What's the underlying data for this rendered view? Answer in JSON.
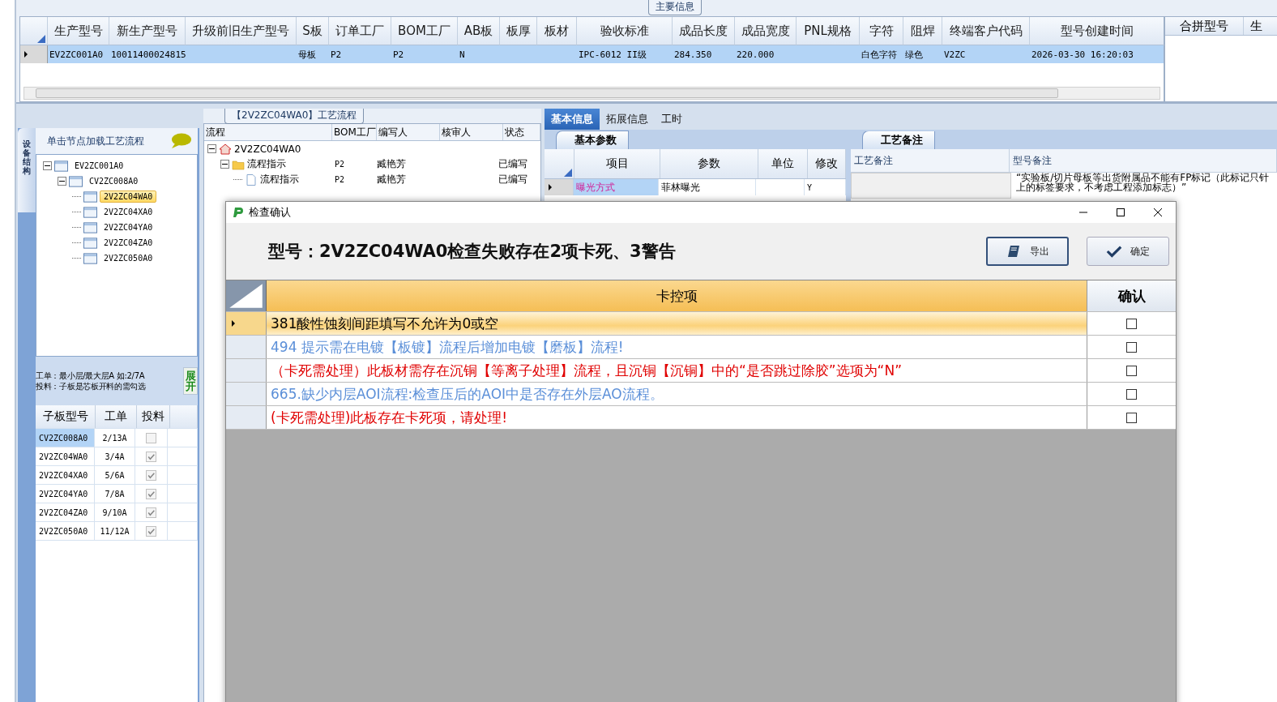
{
  "main_info": {
    "title": "主要信息",
    "columns": [
      "生产型号",
      "新生产型号",
      "升级前旧生产型号",
      "S板",
      "订单工厂",
      "BOM工厂",
      "AB板",
      "板厚",
      "板材",
      "验收标准",
      "成品长度",
      "成品宽度",
      "PNL规格",
      "字符",
      "阻焊",
      "终端客户代码",
      "型号创建时间"
    ],
    "rows": [
      {
        "selected": true,
        "cells": [
          "EV2ZC001A0",
          "10011400024815",
          "",
          "母板",
          "P2",
          "P2",
          "N",
          "",
          "",
          "IPC-6012 II级",
          "284.350",
          "220.000",
          "",
          "白色字符",
          "绿色",
          "V2ZC",
          "2026-03-30 16:20:03"
        ]
      }
    ]
  },
  "merge_table": {
    "columns": [
      "合拼型号",
      "生"
    ]
  },
  "left_panel": {
    "side_tab": "设备结构",
    "hint": "单击节点加载工艺流程",
    "tree": [
      {
        "label": "EV2ZC001A0",
        "expanded": true,
        "selected": false,
        "children": [
          {
            "label": "CV2ZC008A0",
            "expanded": true,
            "selected": false,
            "children": [
              {
                "label": "2V2ZC04WA0",
                "selected": true
              },
              {
                "label": "2V2ZC04XA0",
                "selected": false
              },
              {
                "label": "2V2ZC04YA0",
                "selected": false
              },
              {
                "label": "2V2ZC04ZA0",
                "selected": false
              },
              {
                "label": "2V2ZC050A0",
                "selected": false
              }
            ]
          }
        ]
      }
    ],
    "notes": [
      "工单：最小层/最大层A 如:2/7A",
      "投料：子板是芯板开料的需勾选"
    ],
    "expand_button": "展开",
    "sub_table": {
      "columns": [
        "子板型号",
        "工单",
        "投料"
      ],
      "rows": [
        {
          "model": "CV2ZC008A0",
          "order": "2/13A",
          "checked": false,
          "selected": true
        },
        {
          "model": "2V2ZC04WA0",
          "order": "3/4A",
          "checked": true,
          "selected": false
        },
        {
          "model": "2V2ZC04XA0",
          "order": "5/6A",
          "checked": true,
          "selected": false
        },
        {
          "model": "2V2ZC04YA0",
          "order": "7/8A",
          "checked": true,
          "selected": false
        },
        {
          "model": "2V2ZC04ZA0",
          "order": "9/10A",
          "checked": true,
          "selected": false
        },
        {
          "model": "2V2ZC050A0",
          "order": "11/12A",
          "checked": true,
          "selected": false
        }
      ]
    }
  },
  "flow_panel": {
    "title": "【2V2ZC04WA0】工艺流程",
    "columns": [
      "流程",
      "BOM工厂",
      "编写人",
      "核审人",
      "状态"
    ],
    "tree": [
      {
        "label": "2V2ZC04WA0",
        "kind": "home",
        "children": [
          {
            "label": "流程指示",
            "kind": "folder",
            "bom": "P2",
            "author": "臧艳芳",
            "status": "已编写",
            "children": [
              {
                "label": "流程指示",
                "kind": "file",
                "bom": "P2",
                "author": "臧艳芳",
                "status": "已编写"
              }
            ]
          }
        ]
      }
    ]
  },
  "info_tabs": [
    {
      "label": "基本信息",
      "selected": true
    },
    {
      "label": "拓展信息",
      "selected": false
    },
    {
      "label": "工时",
      "selected": false
    }
  ],
  "basic_params": {
    "tab": "基本参数",
    "columns": [
      "项目",
      "参数",
      "单位",
      "修改"
    ],
    "rows": [
      {
        "item": "曝光方式",
        "param": "菲林曝光",
        "modified": "Y"
      }
    ]
  },
  "process_notes": {
    "tab": "工艺备注",
    "columns": [
      "工艺备注",
      "型号备注"
    ],
    "model_note": [
      "“实验板/切片母板等出货附属品不能有FP标记（此标记只针",
      "上的标签要求，不考虑工程添加标志）”"
    ]
  },
  "dialog": {
    "title": "检查确认",
    "heading": "型号：2V2ZC04WA0检查失败存在2项卡死、3警告",
    "buttons": [
      {
        "label": "导出",
        "kind": "export"
      },
      {
        "label": "确定",
        "kind": "ok"
      }
    ],
    "columns": [
      "卡控项",
      "确认"
    ],
    "rows": [
      {
        "text": "381酸性蚀刻间距填写不允许为0或空",
        "color": "#000000",
        "selected": true,
        "checked": false
      },
      {
        "text": "494 提示需在电镀【板镀】流程后增加电镀【磨板】流程!",
        "color": "#5b8fd8",
        "selected": false,
        "checked": false
      },
      {
        "text": "（卡死需处理）此板材需存在沉铜【等离子处理】流程，且沉铜【沉铜】中的“是否跳过除胶”选项为“N”",
        "color": "#e00000",
        "selected": false,
        "checked": false
      },
      {
        "text": "665.缺少内层AOI流程:检查压后的AOI中是否存在外层AO流程。",
        "color": "#5b8fd8",
        "selected": false,
        "checked": false
      },
      {
        "text": "(卡死需处理)此板存在卡死项，请处理!",
        "color": "#e00000",
        "selected": false,
        "checked": false
      }
    ]
  }
}
